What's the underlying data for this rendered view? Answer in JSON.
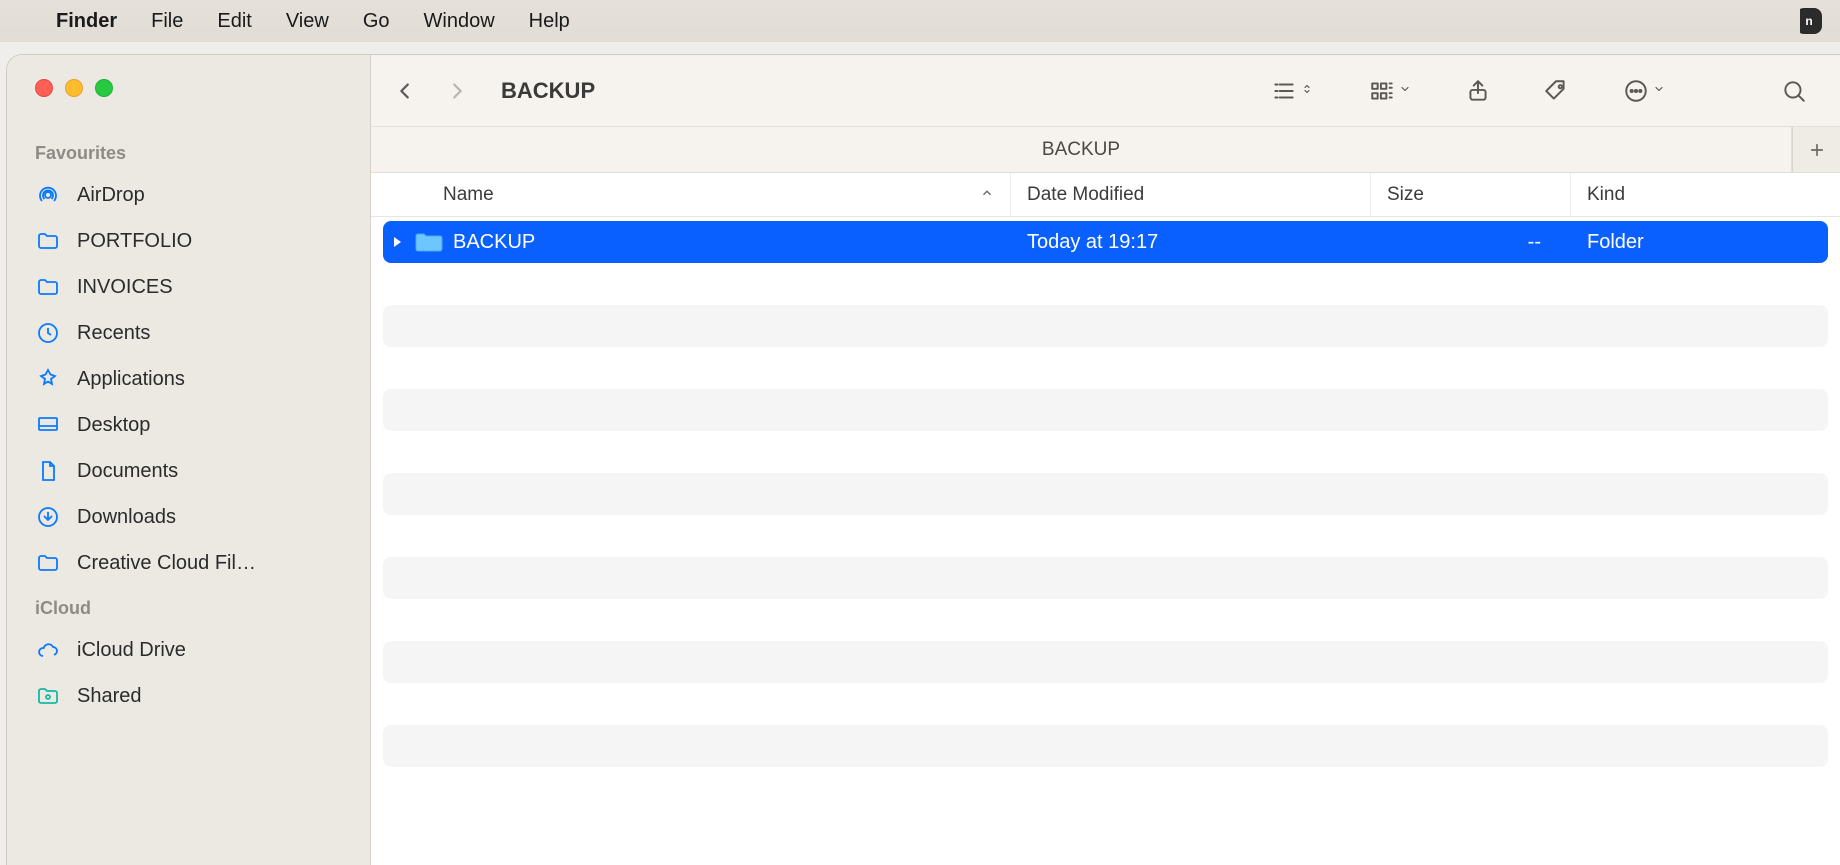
{
  "menubar": {
    "app_name": "Finder",
    "items": [
      "File",
      "Edit",
      "View",
      "Go",
      "Window",
      "Help"
    ]
  },
  "window": {
    "title": "BACKUP",
    "tab_label": "BACKUP"
  },
  "sidebar": {
    "sections": [
      {
        "title": "Favourites",
        "items": [
          {
            "icon": "airdrop",
            "label": "AirDrop"
          },
          {
            "icon": "folder",
            "label": "PORTFOLIO"
          },
          {
            "icon": "folder",
            "label": "INVOICES"
          },
          {
            "icon": "clock",
            "label": "Recents"
          },
          {
            "icon": "apps",
            "label": "Applications"
          },
          {
            "icon": "desktop",
            "label": "Desktop"
          },
          {
            "icon": "document",
            "label": "Documents"
          },
          {
            "icon": "download",
            "label": "Downloads"
          },
          {
            "icon": "folder",
            "label": "Creative Cloud Fil…"
          }
        ]
      },
      {
        "title": "iCloud",
        "items": [
          {
            "icon": "cloud",
            "label": "iCloud Drive"
          },
          {
            "icon": "shared",
            "label": "Shared"
          }
        ]
      }
    ]
  },
  "columns": {
    "name": "Name",
    "date": "Date Modified",
    "size": "Size",
    "kind": "Kind"
  },
  "rows": [
    {
      "name": "BACKUP",
      "date": "Today at 19:17",
      "size": "--",
      "kind": "Folder",
      "selected": true
    }
  ]
}
